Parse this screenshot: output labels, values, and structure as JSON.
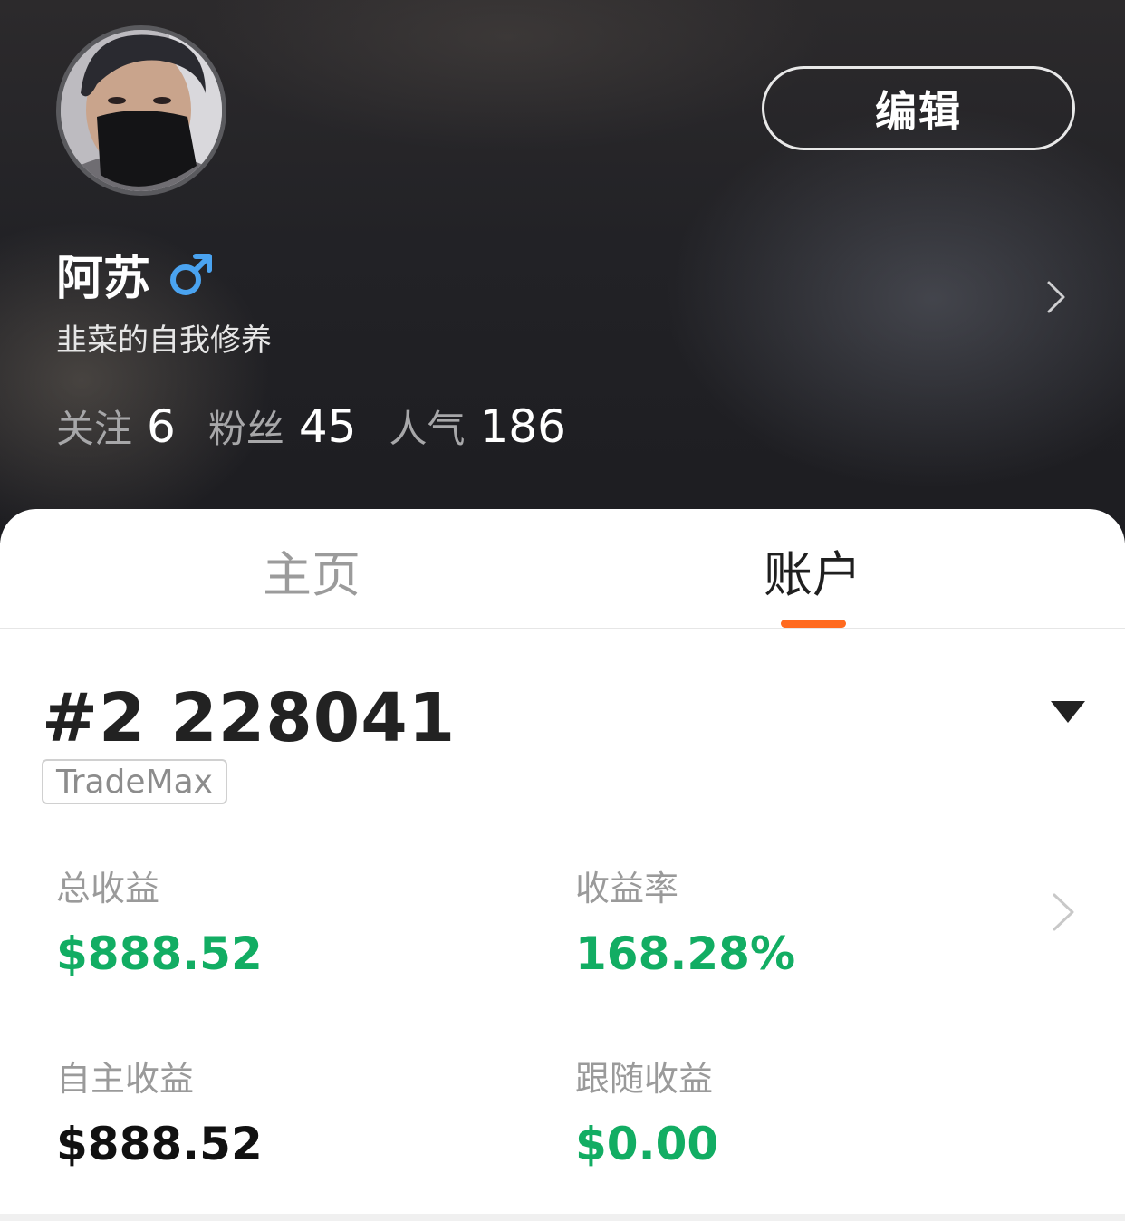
{
  "profile": {
    "name": "阿苏",
    "gender_icon": "male-symbol-icon",
    "bio": "韭菜的自我修养",
    "edit_label": "编辑",
    "stats": [
      {
        "label": "关注",
        "value": "6"
      },
      {
        "label": "粉丝",
        "value": "45"
      },
      {
        "label": "人气",
        "value": "186"
      }
    ]
  },
  "tabs": [
    {
      "label": "主页",
      "active": false
    },
    {
      "label": "账户",
      "active": true
    }
  ],
  "account": {
    "number": "#2  228041",
    "broker": "TradeMax",
    "metrics": {
      "total_profit": {
        "label": "总收益",
        "value": "$888.52"
      },
      "return_rate": {
        "label": "收益率",
        "value": "168.28%"
      },
      "self_profit": {
        "label": "自主收益",
        "value": "$888.52"
      },
      "follow_profit": {
        "label": "跟随收益",
        "value": "$0.00"
      }
    }
  },
  "colors": {
    "accent": "#ff6a1f",
    "positive": "#12ad63",
    "gender_blue": "#4aa3f0"
  }
}
